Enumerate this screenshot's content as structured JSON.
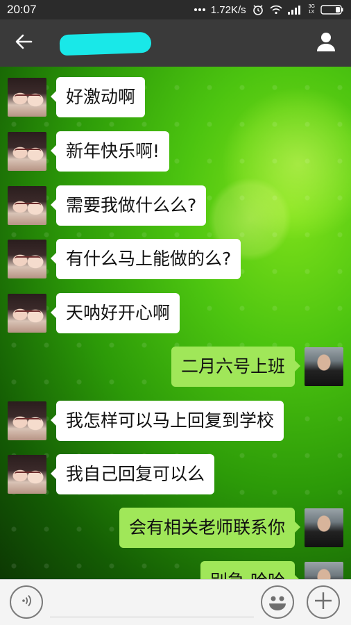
{
  "status_bar": {
    "time": "20:07",
    "network_speed": "1.72K/s",
    "icons": [
      "more-dots-icon",
      "alarm-icon",
      "wifi-icon",
      "signal-icon",
      "battery-icon"
    ],
    "signal_label_top": "3G",
    "signal_label_bottom": "1X"
  },
  "header": {
    "title": "",
    "back_icon": "back-arrow-icon",
    "profile_icon": "person-icon"
  },
  "messages": [
    {
      "side": "left",
      "text": "好激动啊"
    },
    {
      "side": "left",
      "text": "新年快乐啊!"
    },
    {
      "side": "left",
      "text": "需要我做什么么?"
    },
    {
      "side": "left",
      "text": "有什么马上能做的么?"
    },
    {
      "side": "left",
      "text": "天呐好开心啊"
    },
    {
      "side": "right",
      "text": "二月六号上班"
    },
    {
      "side": "left",
      "text": "我怎样可以马上回复到学校"
    },
    {
      "side": "left",
      "text": "我自己回复可以么"
    },
    {
      "side": "right",
      "text": "会有相关老师联系你"
    },
    {
      "side": "right",
      "text": "别急 哈哈"
    }
  ],
  "input_bar": {
    "placeholder": "",
    "icons": [
      "voice-icon",
      "emoji-icon",
      "plus-icon"
    ]
  },
  "colors": {
    "incoming_bubble": "#ffffff",
    "outgoing_bubble": "#a0e759",
    "app_bar": "#3a3a3a",
    "status_bar": "#2b2b2b"
  }
}
